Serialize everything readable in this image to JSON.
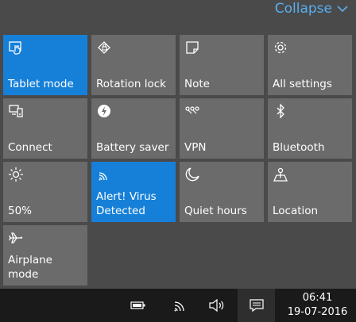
{
  "header": {
    "collapse_label": "Collapse"
  },
  "tiles": [
    {
      "label": "Tablet mode",
      "icon": "tablet-mode-icon",
      "active": true
    },
    {
      "label": "Rotation lock",
      "icon": "rotation-lock-icon",
      "active": false
    },
    {
      "label": "Note",
      "icon": "note-icon",
      "active": false
    },
    {
      "label": "All settings",
      "icon": "gear-icon",
      "active": false
    },
    {
      "label": "Connect",
      "icon": "connect-icon",
      "active": false
    },
    {
      "label": "Battery saver",
      "icon": "battery-saver-icon",
      "active": false
    },
    {
      "label": "VPN",
      "icon": "vpn-icon",
      "active": false
    },
    {
      "label": "Bluetooth",
      "icon": "bluetooth-icon",
      "active": false
    },
    {
      "label": "50%",
      "icon": "brightness-icon",
      "active": false
    },
    {
      "label": "Alert! Virus Detected",
      "icon": "wifi-icon",
      "active": true
    },
    {
      "label": "Quiet hours",
      "icon": "moon-icon",
      "active": false
    },
    {
      "label": "Location",
      "icon": "location-icon",
      "active": false
    },
    {
      "label": "Airplane mode",
      "icon": "airplane-icon",
      "active": false
    }
  ],
  "taskbar": {
    "time": "06:41",
    "date": "19-07-2016",
    "icons": [
      "battery-icon",
      "wifi-icon",
      "volume-icon",
      "action-center-icon"
    ]
  },
  "colors": {
    "accent": "#1680d8",
    "tile": "#6b6b6b",
    "panel": "#4a4a4a",
    "taskbar": "#1a1a1a",
    "link": "#5aaef0"
  }
}
